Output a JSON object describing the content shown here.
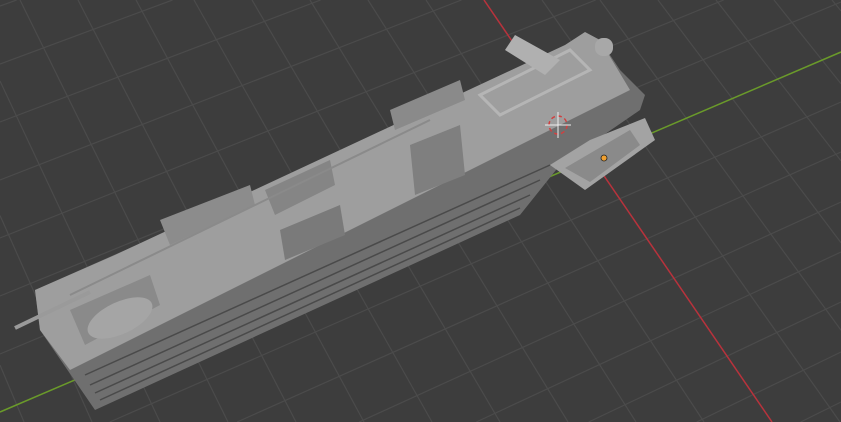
{
  "viewport": {
    "colors": {
      "background": "#3d3d3d",
      "grid": "#4b4b4b",
      "x_axis": "#b8323c",
      "y_axis": "#6a9a2a",
      "model": "#9a9a9a",
      "model_shadow": "#6e6e6e",
      "origin": "#f0a030",
      "cursor": "#d04040"
    }
  }
}
